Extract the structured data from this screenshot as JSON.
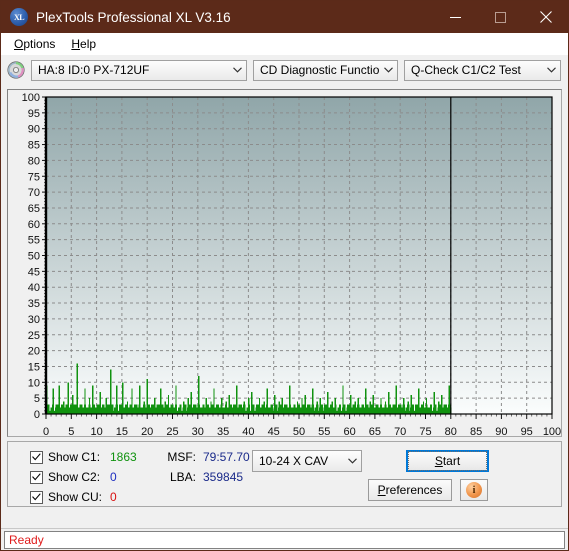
{
  "window": {
    "title": "PlexTools Professional XL V3.16",
    "app_icon": "XL",
    "minimize": "minimize-icon",
    "maximize": "maximize-icon",
    "close": "close-icon"
  },
  "menu": {
    "items": [
      {
        "label": "Options",
        "accel": "O"
      },
      {
        "label": "Help",
        "accel": "H"
      }
    ]
  },
  "toolbar": {
    "drive_select": "HA:8 ID:0  PX-712UF",
    "function_select": "CD Diagnostic Functions",
    "test_select": "Q-Check C1/C2 Test"
  },
  "controls": {
    "checkboxes": [
      {
        "label": "Show C1:",
        "value": "1863",
        "color": "#10920f",
        "checked": true
      },
      {
        "label": "Show C2:",
        "value": "0",
        "color": "#1f2fc0",
        "checked": true
      },
      {
        "label": "Show CU:",
        "value": "0",
        "color": "#d81010",
        "checked": true
      }
    ],
    "stats": [
      {
        "label": "MSF:",
        "value": "79:57.70"
      },
      {
        "label": "LBA:",
        "value": "359845"
      }
    ],
    "speed_select": "10-24 X CAV",
    "start_button": "Start",
    "start_accel": "S",
    "preferences_button": "Preferences",
    "preferences_accel": "P",
    "info_button": "i"
  },
  "status": {
    "text": "Ready"
  },
  "colors": {
    "titlebar": "#5c2a19",
    "c1": "#10920f",
    "c2": "#1f2fc0",
    "cu": "#d81010",
    "plot_top": "#90a6a9",
    "plot_bottom": "#fbfdfd",
    "grid": "#8c8c8c",
    "accent": "#0078d7"
  },
  "chart_data": {
    "type": "bar",
    "title": "",
    "xlabel": "",
    "ylabel": "",
    "xlim": [
      0,
      100
    ],
    "ylim": [
      0,
      100
    ],
    "xticks": [
      0,
      5,
      10,
      15,
      20,
      25,
      30,
      35,
      40,
      45,
      50,
      55,
      60,
      65,
      70,
      75,
      80,
      85,
      90,
      95,
      100
    ],
    "yticks": [
      0,
      5,
      10,
      15,
      20,
      25,
      30,
      35,
      40,
      45,
      50,
      55,
      60,
      65,
      70,
      75,
      80,
      85,
      90,
      95,
      100
    ],
    "grid": true,
    "legend_position": "none",
    "data_end_marker_x": 80,
    "series": [
      {
        "name": "C1",
        "color": "#10920f",
        "total": 1863,
        "x": [
          0.2,
          0.5,
          0.8,
          1.1,
          1.4,
          1.7,
          2.0,
          2.3,
          2.6,
          2.9,
          3.2,
          3.5,
          3.8,
          4.1,
          4.4,
          4.7,
          5.0,
          5.3,
          5.6,
          5.9,
          6.2,
          6.5,
          6.8,
          7.1,
          7.4,
          7.7,
          8.0,
          8.3,
          8.6,
          8.9,
          9.2,
          9.5,
          9.8,
          10.1,
          10.4,
          10.7,
          11.0,
          11.3,
          11.6,
          11.9,
          12.2,
          12.5,
          12.8,
          13.1,
          13.4,
          13.7,
          14.0,
          14.3,
          14.6,
          14.9,
          15.2,
          15.5,
          15.8,
          16.1,
          16.4,
          16.7,
          17.0,
          17.3,
          17.6,
          17.9,
          18.2,
          18.5,
          18.8,
          19.1,
          19.4,
          19.7,
          20.0,
          20.3,
          20.6,
          20.9,
          21.2,
          21.5,
          21.8,
          22.1,
          22.4,
          22.7,
          23.0,
          23.3,
          23.6,
          23.9,
          24.2,
          24.5,
          24.8,
          25.1,
          25.4,
          25.7,
          26.0,
          26.3,
          26.6,
          26.9,
          27.2,
          27.5,
          27.8,
          28.1,
          28.4,
          28.7,
          29.0,
          29.3,
          29.6,
          29.9,
          30.2,
          30.5,
          30.8,
          31.1,
          31.4,
          31.7,
          32.0,
          32.3,
          32.6,
          32.9,
          33.2,
          33.5,
          33.8,
          34.1,
          34.4,
          34.7,
          35.0,
          35.3,
          35.6,
          35.9,
          36.2,
          36.5,
          36.8,
          37.1,
          37.4,
          37.7,
          38.0,
          38.3,
          38.6,
          38.9,
          39.2,
          39.5,
          39.8,
          40.1,
          40.4,
          40.7,
          41.0,
          41.3,
          41.6,
          41.9,
          42.2,
          42.5,
          42.8,
          43.1,
          43.4,
          43.7,
          44.0,
          44.3,
          44.6,
          44.9,
          45.2,
          45.5,
          45.8,
          46.1,
          46.4,
          46.7,
          47.0,
          47.3,
          47.6,
          47.9,
          48.2,
          48.5,
          48.8,
          49.1,
          49.4,
          49.7,
          50.0,
          50.3,
          50.6,
          50.9,
          51.2,
          51.5,
          51.8,
          52.1,
          52.4,
          52.7,
          53.0,
          53.3,
          53.6,
          53.9,
          54.2,
          54.5,
          54.8,
          55.1,
          55.4,
          55.7,
          56.0,
          56.3,
          56.6,
          56.9,
          57.2,
          57.5,
          57.8,
          58.1,
          58.4,
          58.7,
          59.0,
          59.3,
          59.6,
          59.9,
          60.2,
          60.5,
          60.8,
          61.1,
          61.4,
          61.7,
          62.0,
          62.3,
          62.6,
          62.9,
          63.2,
          63.5,
          63.8,
          64.1,
          64.4,
          64.7,
          65.0,
          65.3,
          65.6,
          65.9,
          66.2,
          66.5,
          66.8,
          67.1,
          67.4,
          67.7,
          68.0,
          68.3,
          68.6,
          68.9,
          69.2,
          69.5,
          69.8,
          70.1,
          70.4,
          70.7,
          71.0,
          71.3,
          71.6,
          71.9,
          72.2,
          72.5,
          72.8,
          73.1,
          73.4,
          73.7,
          74.0,
          74.3,
          74.6,
          74.9,
          75.2,
          75.5,
          75.8,
          76.1,
          76.4,
          76.7,
          77.0,
          77.3,
          77.6,
          77.9,
          78.2,
          78.5,
          78.8,
          79.1,
          79.4,
          79.7,
          80.0
        ],
        "values": [
          9,
          3,
          1,
          2,
          8,
          1,
          3,
          1,
          9,
          2,
          1,
          4,
          2,
          1,
          10,
          1,
          2,
          6,
          3,
          1,
          16,
          2,
          1,
          3,
          2,
          8,
          2,
          1,
          5,
          2,
          9,
          1,
          2,
          3,
          1,
          7,
          2,
          1,
          2,
          5,
          1,
          3,
          14,
          2,
          1,
          2,
          9,
          1,
          3,
          2,
          10,
          1,
          2,
          4,
          1,
          2,
          8,
          1,
          2,
          3,
          1,
          9,
          2,
          1,
          4,
          2,
          11,
          1,
          2,
          3,
          1,
          5,
          2,
          1,
          3,
          8,
          1,
          2,
          4,
          1,
          6,
          2,
          1,
          3,
          2,
          9,
          1,
          2,
          3,
          1,
          4,
          2,
          1,
          5,
          2,
          7,
          1,
          2,
          3,
          1,
          12,
          2,
          1,
          3,
          2,
          5,
          1,
          2,
          4,
          1,
          8,
          2,
          1,
          3,
          1,
          5,
          2,
          1,
          4,
          2,
          6,
          1,
          2,
          3,
          1,
          9,
          2,
          1,
          3,
          2,
          4,
          1,
          2,
          5,
          1,
          7,
          2,
          1,
          3,
          2,
          5,
          1,
          2,
          4,
          1,
          8,
          2,
          1,
          3,
          1,
          6,
          2,
          1,
          4,
          2,
          5,
          1,
          2,
          3,
          1,
          9,
          2,
          1,
          3,
          2,
          4,
          1,
          2,
          5,
          1,
          6,
          2,
          1,
          3,
          2,
          8,
          1,
          2,
          4,
          1,
          5,
          2,
          1,
          3,
          1,
          7,
          2,
          1,
          4,
          2,
          5,
          1,
          2,
          3,
          1,
          9,
          2,
          1,
          3,
          2,
          6,
          1,
          2,
          4,
          1,
          5,
          2,
          1,
          3,
          2,
          8,
          1,
          2,
          4,
          1,
          6,
          2,
          1,
          3,
          1,
          5,
          2,
          1,
          4,
          2,
          7,
          1,
          2,
          3,
          1,
          9,
          2,
          1,
          3,
          2,
          5,
          1,
          2,
          4,
          1,
          6,
          2,
          1,
          3,
          2,
          8,
          1,
          2,
          4,
          1,
          5,
          2,
          1,
          3,
          1,
          7,
          2,
          1,
          4,
          2,
          6,
          1,
          2,
          3,
          1,
          9,
          2,
          1,
          3,
          2,
          5,
          1,
          2,
          4,
          1,
          11,
          2,
          1
        ]
      },
      {
        "name": "C2",
        "color": "#1f2fc0",
        "total": 0,
        "x": [],
        "values": []
      },
      {
        "name": "CU",
        "color": "#d81010",
        "total": 0,
        "x": [],
        "values": []
      }
    ]
  }
}
